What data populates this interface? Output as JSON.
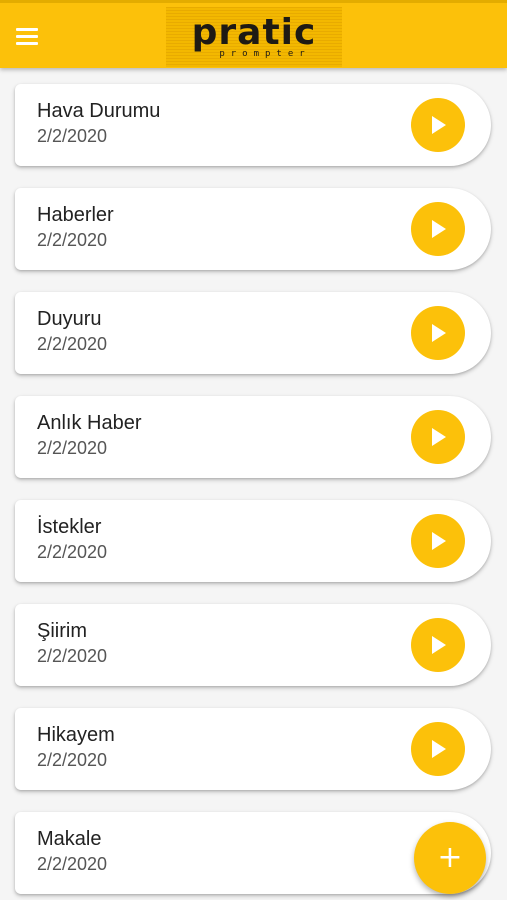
{
  "header": {
    "logo_text": "pratic",
    "logo_subtext": "prompter",
    "menu_icon": "hamburger-menu-icon"
  },
  "items": [
    {
      "title": "Hava Durumu",
      "date": "2/2/2020"
    },
    {
      "title": "Haberler",
      "date": "2/2/2020"
    },
    {
      "title": "Duyuru",
      "date": "2/2/2020"
    },
    {
      "title": "Anlık Haber",
      "date": "2/2/2020"
    },
    {
      "title": "İstekler",
      "date": "2/2/2020"
    },
    {
      "title": "Şiirim",
      "date": "2/2/2020"
    },
    {
      "title": "Hikayem",
      "date": "2/2/2020"
    },
    {
      "title": "Makale",
      "date": "2/2/2020"
    }
  ],
  "fab": {
    "label": "+",
    "icon": "plus-icon"
  },
  "colors": {
    "accent": "#fcc10a",
    "card_bg": "#ffffff",
    "page_bg": "#f5f5f5"
  }
}
